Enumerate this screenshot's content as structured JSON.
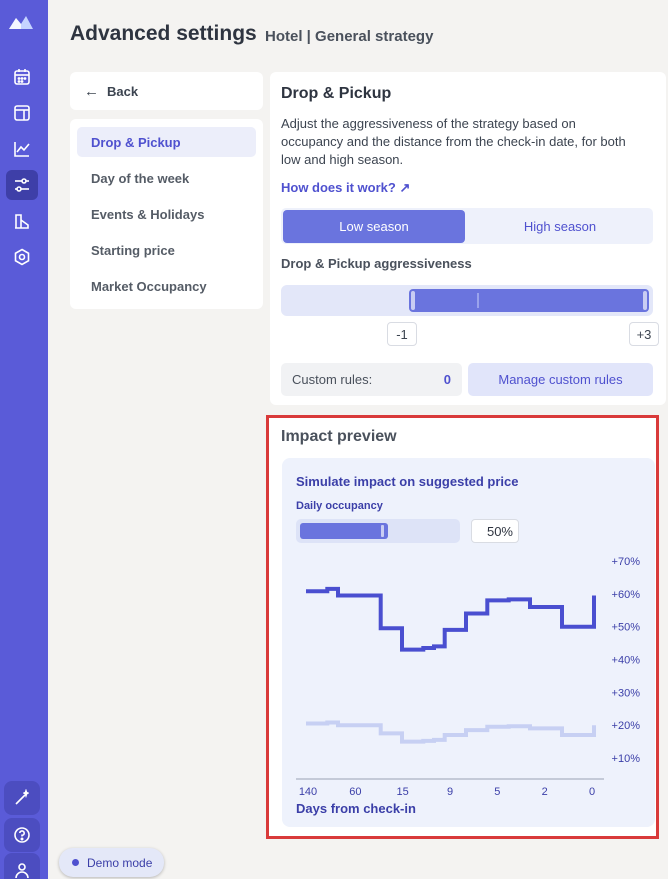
{
  "header": {
    "title": "Advanced settings",
    "subtitle": "Hotel | General strategy"
  },
  "sidebar": {
    "back_label": "Back",
    "items": [
      {
        "label": "Drop & Pickup",
        "active": true
      },
      {
        "label": "Day of the week",
        "active": false
      },
      {
        "label": "Events & Holidays",
        "active": false
      },
      {
        "label": "Starting price",
        "active": false
      },
      {
        "label": "Market Occupancy",
        "active": false
      }
    ]
  },
  "rail": {
    "icons": [
      "logo-icon",
      "calendar-icon",
      "layout-icon",
      "chart-line-icon",
      "sliders-icon",
      "building-icon",
      "settings-icon"
    ],
    "bottom_icons": [
      "magic-wand-icon",
      "help-icon",
      "user-icon"
    ]
  },
  "drop_pickup": {
    "title": "Drop & Pickup",
    "description": "Adjust the aggressiveness of the strategy based on occupancy and the distance from the check-in date, for both low and high season.",
    "how_link": "How does it work? ↗",
    "seasons": {
      "low": "Low season",
      "high": "High season",
      "selected": "low"
    },
    "aggressiveness_label": "Drop & Pickup aggressiveness",
    "range_min_label": "-1",
    "range_max_label": "+3",
    "custom_rules_label": "Custom rules:",
    "custom_rules_count": "0",
    "manage_button": "Manage custom rules"
  },
  "impact": {
    "title": "Impact preview",
    "sim_title": "Simulate impact on suggested price",
    "occupancy_label": "Daily occupancy",
    "occupancy_value": "50%",
    "occupancy_fraction": 0.5,
    "xlabel": "Days from check-in"
  },
  "chart_data": {
    "type": "line",
    "x_tick_labels": [
      "140",
      "60",
      "15",
      "9",
      "5",
      "2",
      "0"
    ],
    "y_tick_labels": [
      "+70%",
      "+60%",
      "+50%",
      "+40%",
      "+30%",
      "+20%",
      "+10%"
    ],
    "ylim": [
      10,
      70
    ],
    "series": [
      {
        "style": "step",
        "color": "#4a4fd0",
        "points": [
          [
            0,
            60.8
          ],
          [
            0.05,
            60.8
          ],
          [
            0.1,
            61.5
          ],
          [
            0.15,
            59.5
          ],
          [
            0.3,
            59.5
          ],
          [
            0.35,
            49.5
          ],
          [
            0.4,
            49.5
          ],
          [
            0.45,
            43
          ],
          [
            0.55,
            43.5
          ],
          [
            0.6,
            44
          ],
          [
            0.65,
            49
          ],
          [
            0.7,
            49
          ],
          [
            0.75,
            54
          ],
          [
            0.8,
            54
          ],
          [
            0.85,
            58
          ],
          [
            0.9,
            58
          ],
          [
            0.95,
            58.3
          ],
          [
            1.0,
            58.3
          ],
          [
            1.05,
            56
          ],
          [
            1.15,
            56
          ],
          [
            1.2,
            50
          ],
          [
            1.3,
            50
          ],
          [
            1.35,
            59.5
          ]
        ]
      },
      {
        "style": "step",
        "color": "#c7d0f3",
        "points": [
          [
            0,
            20.5
          ],
          [
            0.05,
            20.5
          ],
          [
            0.1,
            20.8
          ],
          [
            0.15,
            20
          ],
          [
            0.3,
            20
          ],
          [
            0.35,
            17.5
          ],
          [
            0.4,
            17.5
          ],
          [
            0.45,
            15
          ],
          [
            0.55,
            15.2
          ],
          [
            0.6,
            15.5
          ],
          [
            0.65,
            17
          ],
          [
            0.7,
            17
          ],
          [
            0.75,
            18.5
          ],
          [
            0.8,
            18.5
          ],
          [
            0.85,
            19.5
          ],
          [
            0.9,
            19.5
          ],
          [
            0.95,
            19.7
          ],
          [
            1.0,
            19.7
          ],
          [
            1.05,
            19
          ],
          [
            1.15,
            19
          ],
          [
            1.2,
            17
          ],
          [
            1.3,
            17
          ],
          [
            1.35,
            20
          ]
        ]
      }
    ]
  }
}
